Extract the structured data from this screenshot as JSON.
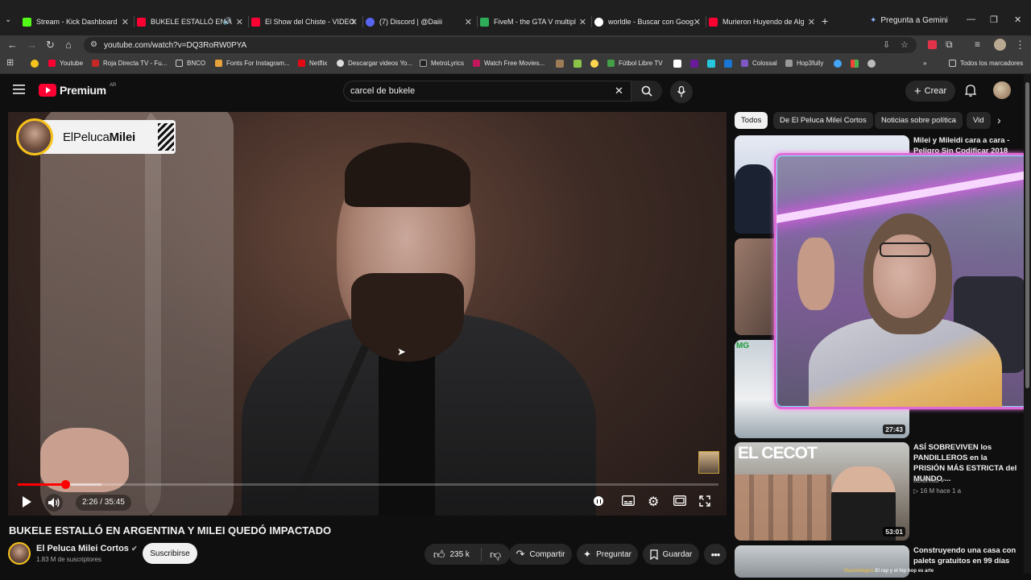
{
  "browser": {
    "tabs": [
      {
        "title": "Stream - Kick Dashboard",
        "color": "#53fc18"
      },
      {
        "title": "BUKELE ESTALLÓ EN A",
        "color": "#ff0033"
      },
      {
        "title": "El Show del Chiste - VIDEO",
        "color": "#ff0033"
      },
      {
        "title": "(7) Discord | @Daiii",
        "color": "#5865f2"
      },
      {
        "title": "FiveM - the GTA V multipl",
        "color": "#2fae5a"
      },
      {
        "title": "worldle - Buscar con Goog",
        "color": "#ffffff"
      },
      {
        "title": "Murieron Huyendo de Alg",
        "color": "#ff0033"
      }
    ],
    "gemini_label": "Pregunta a Gemini",
    "url": "youtube.com/watch?v=DQ3RoRW0PYA",
    "bookmarks": [
      "Youtube",
      "Roja Directa TV - Fu...",
      "BNCO",
      "Fonts For Instagram...",
      "Netflix",
      "Descargar videos Yo...",
      "MetroLyrics",
      "Watch Free Movies...",
      "Fútbol Libre TV",
      "Colossal",
      "Hop3fully"
    ],
    "all_bookmarks_label": "Todos los marcadores"
  },
  "youtube": {
    "logo_text": "Premium",
    "logo_region": "AR",
    "search_value": "carcel de bukele",
    "create_label": "Crear"
  },
  "player": {
    "badge_text_light": "ElPeluca",
    "badge_text_bold": "Milei",
    "time": "2:26 / 35:45",
    "progress_fraction": 0.068
  },
  "video": {
    "title": "BUKELE ESTALLÓ EN ARGENTINA Y MILEI QUEDÓ IMPACTADO",
    "channel": "El Peluca Milei Cortos",
    "subscribers": "1.83 M de suscriptores",
    "subscribe_label": "Suscribirse",
    "likes": "235 k",
    "share_label": "Compartir",
    "ask_label": "Preguntar",
    "save_label": "Guardar"
  },
  "chips": [
    "Todos",
    "De El Peluca Milei Cortos",
    "Noticias sobre política",
    "Vid"
  ],
  "recommendations": [
    {
      "title": "Milei y Mileidi cara a cara - Peligro Sin Codificar 2018",
      "duration": "",
      "channel": "",
      "meta": ""
    },
    {
      "title": "",
      "duration": "27:43",
      "channel": "",
      "meta": ""
    },
    {
      "title": "ASÍ SOBREVIVEN los PANDILLEROS en la PRISIÓN MÁS ESTRICTA del MUNDO ...",
      "duration": "53:01",
      "channel": "JDalmau",
      "meta": "16 M  hace 1 a",
      "thumb_text": "EL CECOT"
    },
    {
      "title": "Construyendo una casa con palets gratuitos en 99 días",
      "duration": "",
      "channel": "",
      "meta": ""
    }
  ],
  "stream_footer": {
    "user": "Maumediapro",
    "text": "El rap y el hip hop es arte"
  }
}
